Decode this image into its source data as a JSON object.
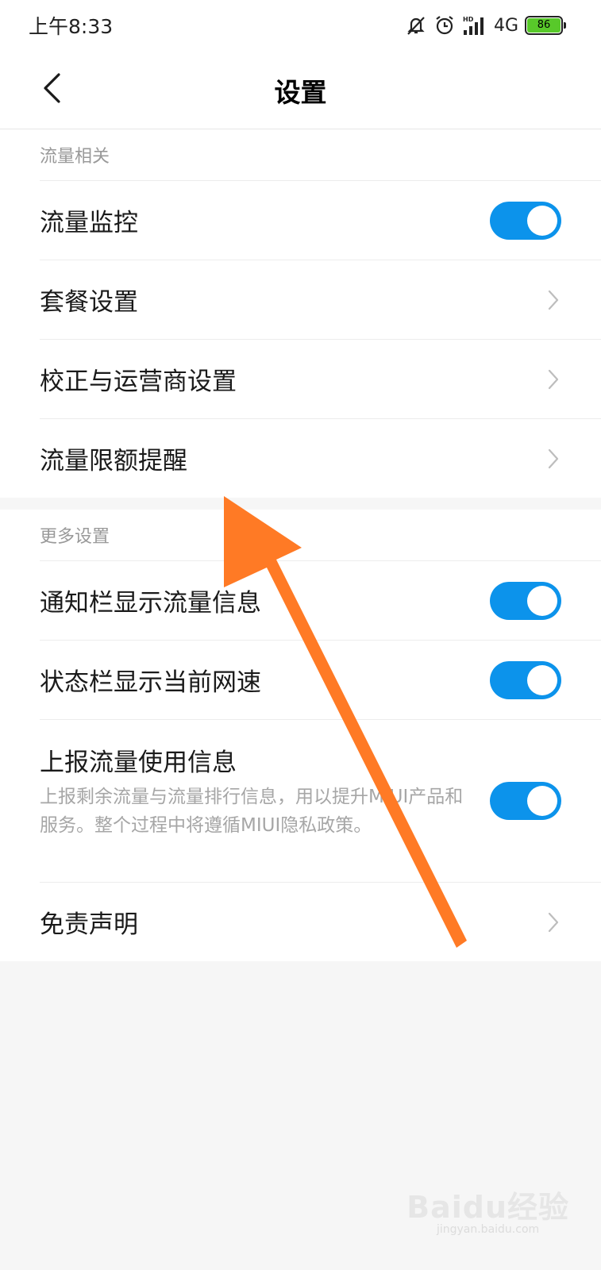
{
  "status_bar": {
    "time": "上午8:33",
    "network": "4G",
    "battery_level": "86",
    "icons": [
      "mute-icon",
      "alarm-icon",
      "hd-signal-icon",
      "battery-icon"
    ]
  },
  "nav": {
    "title": "设置",
    "back_icon": "chevron-left-icon"
  },
  "section_traffic": {
    "header": "流量相关",
    "items": [
      {
        "label": "流量监控",
        "control": "toggle",
        "on": true
      },
      {
        "label": "套餐设置",
        "control": "chevron"
      },
      {
        "label": "校正与运营商设置",
        "control": "chevron"
      },
      {
        "label": "流量限额提醒",
        "control": "chevron"
      }
    ]
  },
  "section_more": {
    "header": "更多设置",
    "items": [
      {
        "label": "通知栏显示流量信息",
        "control": "toggle",
        "on": true
      },
      {
        "label": "状态栏显示当前网速",
        "control": "toggle",
        "on": true
      },
      {
        "label": "上报流量使用信息",
        "description": "上报剩余流量与流量排行信息，用以提升MIUI产品和服务。整个过程中将遵循MIUI隐私政策。",
        "control": "toggle",
        "on": true
      },
      {
        "label": "免责声明",
        "control": "chevron"
      }
    ]
  },
  "colors": {
    "toggle_on": "#0c93eb",
    "annotation_arrow": "#ff7a25",
    "battery": "#58c92a"
  },
  "watermark": {
    "logo": "Baidu经验",
    "url": "jingyan.baidu.com"
  }
}
